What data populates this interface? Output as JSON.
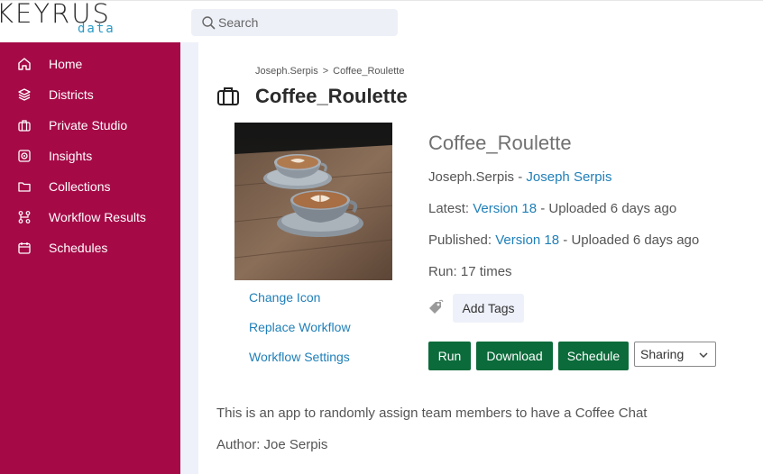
{
  "brand": {
    "name": "KEYRUS",
    "sub": "data",
    "accent": "#a50a47",
    "link_color": "#1f7fb8",
    "button_color": "#0b6b3a"
  },
  "search": {
    "placeholder": "Search",
    "icon": "search-icon"
  },
  "sidebar": {
    "items": [
      {
        "label": "Home",
        "icon": "home-icon"
      },
      {
        "label": "Districts",
        "icon": "layers-icon"
      },
      {
        "label": "Private Studio",
        "icon": "briefcase-icon"
      },
      {
        "label": "Insights",
        "icon": "insights-icon"
      },
      {
        "label": "Collections",
        "icon": "folder-icon"
      },
      {
        "label": "Workflow Results",
        "icon": "workflow-icon"
      },
      {
        "label": "Schedules",
        "icon": "calendar-icon"
      }
    ]
  },
  "breadcrumb": {
    "owner": "Joseph.Serpis",
    "separator": ">",
    "current": "Coffee_Roulette"
  },
  "page": {
    "title": "Coffee_Roulette",
    "title_icon": "briefcase-icon"
  },
  "thumbnail_links": {
    "change_icon": "Change Icon",
    "replace_workflow": "Replace Workflow",
    "workflow_settings": "Workflow Settings"
  },
  "details": {
    "app_name": "Coffee_Roulette",
    "owner_user": "Joseph.Serpis",
    "owner_sep": " - ",
    "owner_name": "Joseph Serpis",
    "latest_label": "Latest: ",
    "latest_version": "Version 18",
    "latest_suffix": " - Uploaded 6 days ago",
    "published_label": "Published: ",
    "published_version": "Version 18",
    "published_suffix": " - Uploaded 6 days ago",
    "run": "Run: 17 times"
  },
  "tags": {
    "icon": "tag-icon",
    "add_label": "Add Tags"
  },
  "actions": {
    "run": "Run",
    "download": "Download",
    "schedule": "Schedule",
    "sharing": "Sharing"
  },
  "description": {
    "text": "This is an app to randomly assign team members to have a Coffee Chat",
    "author": "Author: Joe Serpis"
  }
}
